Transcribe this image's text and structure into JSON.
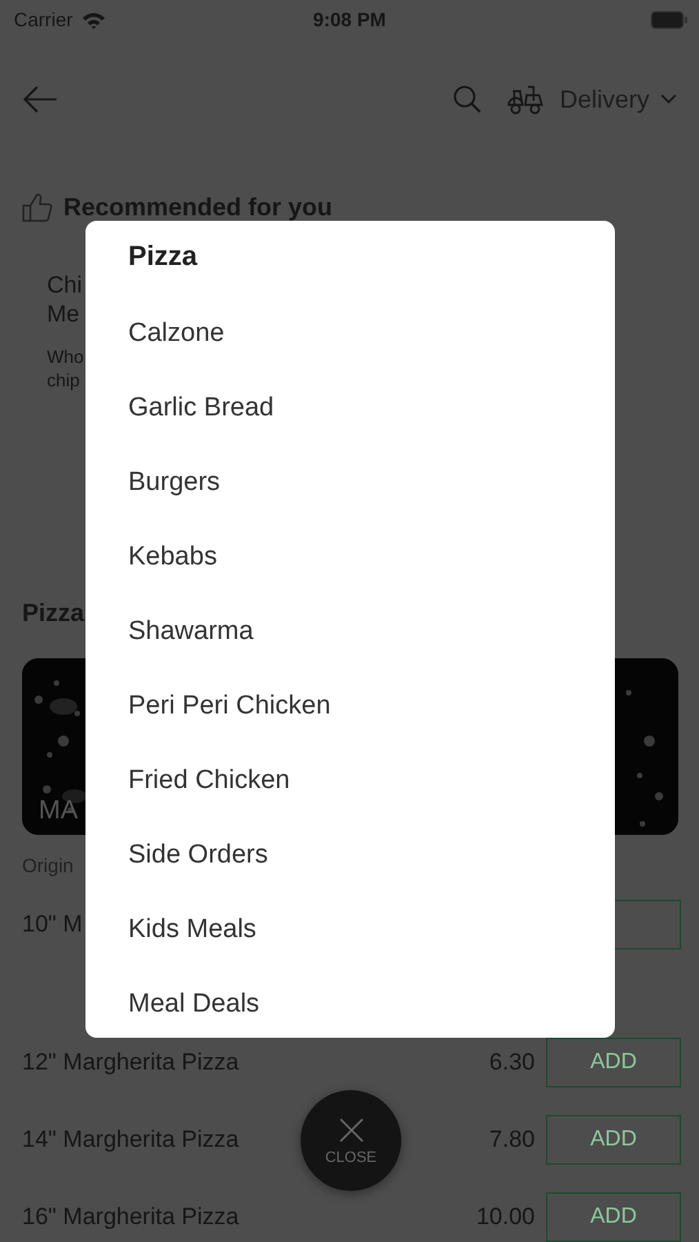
{
  "status_bar": {
    "carrier": "Carrier",
    "time": "9:08 PM"
  },
  "nav": {
    "order_mode": "Delivery"
  },
  "recommended": {
    "title": "Recommended for you",
    "item_name_lines": [
      "Chi",
      "Me"
    ],
    "description_lines": [
      "Who",
      "chip"
    ]
  },
  "section": {
    "title": "Pizza",
    "banner": {
      "kind": "picture",
      "caption": "MA"
    },
    "note": "Origin"
  },
  "rows": [
    {
      "name": "10\" M"
    },
    {
      "name": "12\" Margherita Pizza",
      "price": "6.30",
      "button": "ADD"
    },
    {
      "name": "14\" Margherita Pizza",
      "price": "7.80",
      "button": "ADD"
    },
    {
      "name": "16\" Margherita Pizza",
      "price": "10.00",
      "button": "ADD"
    }
  ],
  "category_sheet": {
    "title": "Pizza",
    "items": [
      "Calzone",
      "Garlic Bread",
      "Burgers",
      "Kebabs",
      "Shawarma",
      "Peri Peri Chicken",
      "Fried Chicken",
      "Side Orders",
      "Kids Meals",
      "Meal Deals"
    ],
    "close_label": "CLOSE"
  }
}
